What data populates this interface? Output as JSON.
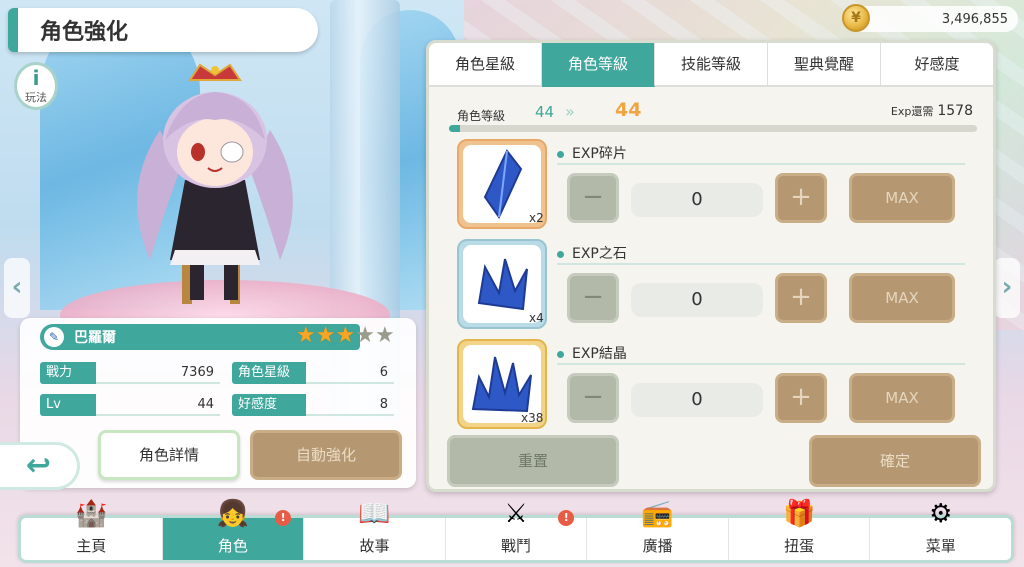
{
  "header": {
    "title": "角色強化",
    "help_label": "玩法",
    "help_glyph": "i"
  },
  "currency": {
    "coins": "3,496,855",
    "coin_icon": "coin-icon"
  },
  "character": {
    "name": "巴羅爾",
    "stars_total": 5,
    "stars_filled": 3,
    "stats": {
      "power_label": "戰力",
      "power_value": "7369",
      "star_label": "角色星級",
      "star_value": "6",
      "lv_label": "Lv",
      "lv_value": "44",
      "affection_label": "好感度",
      "affection_value": "8"
    },
    "detail_button": "角色詳情",
    "auto_button": "自動強化"
  },
  "tabs": [
    {
      "label": "角色星級",
      "active": false
    },
    {
      "label": "角色等級",
      "active": true
    },
    {
      "label": "技能等級",
      "active": false
    },
    {
      "label": "聖典覺醒",
      "active": false
    },
    {
      "label": "好感度",
      "active": false
    }
  ],
  "level": {
    "label": "角色等級",
    "current": "44",
    "next": "44",
    "exp_label": "Exp還需",
    "exp_value": "1578",
    "progress": 0.02
  },
  "items": [
    {
      "name": "EXP碎片",
      "qty": "x2",
      "count": "0",
      "max_label": "MAX",
      "minus": "−",
      "plus": "+"
    },
    {
      "name": "EXP之石",
      "qty": "x4",
      "count": "0",
      "max_label": "MAX",
      "minus": "−",
      "plus": "+"
    },
    {
      "name": "EXP結晶",
      "qty": "x38",
      "count": "0",
      "max_label": "MAX",
      "minus": "−",
      "plus": "+"
    }
  ],
  "actions": {
    "reset": "重置",
    "confirm": "確定"
  },
  "bottom_nav": [
    {
      "label": "主頁",
      "icon": "castle-icon",
      "active": false,
      "badge": ""
    },
    {
      "label": "角色",
      "icon": "character-icon",
      "active": true,
      "badge": "!"
    },
    {
      "label": "故事",
      "icon": "book-icon",
      "active": false,
      "badge": ""
    },
    {
      "label": "戰鬥",
      "icon": "sword-icon",
      "active": false,
      "badge": "!"
    },
    {
      "label": "廣播",
      "icon": "radio-icon",
      "active": false,
      "badge": ""
    },
    {
      "label": "扭蛋",
      "icon": "gacha-icon",
      "active": false,
      "badge": ""
    },
    {
      "label": "菜單",
      "icon": "gear-icon",
      "active": false,
      "badge": ""
    }
  ],
  "colors": {
    "accent": "#3fa79c",
    "disabled_brown": "#b59872",
    "star": "#f5a623"
  }
}
